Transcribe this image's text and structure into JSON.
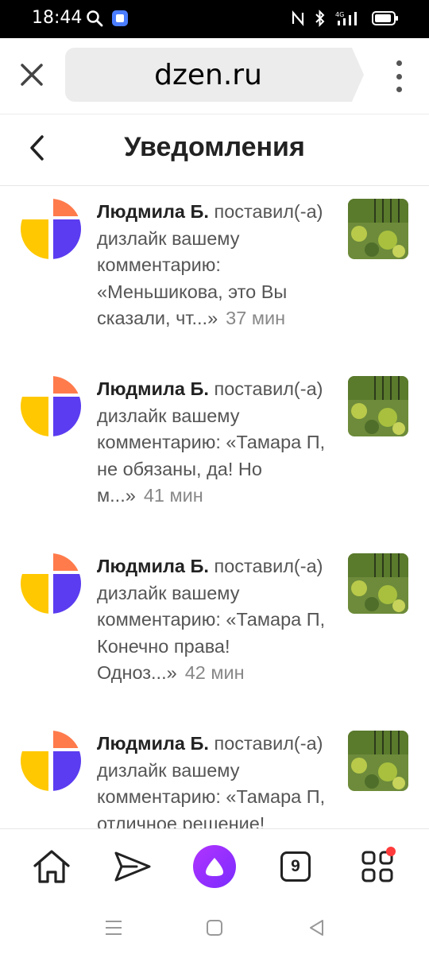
{
  "status_bar": {
    "time": "18:44",
    "network": "4G"
  },
  "browser": {
    "url": "dzen.ru"
  },
  "header": {
    "title": "Уведомления"
  },
  "notifications": [
    {
      "name": "Людмила Б.",
      "text": " поставил(-а) дизлайк вашему комментарию: «Меньшикова, это Вы сказали, чт...»",
      "time": "37 мин"
    },
    {
      "name": "Людмила Б.",
      "text": " поставил(-а) дизлайк вашему комментарию: «Тамара П, не обязаны, да! Но м...»",
      "time": "41 мин"
    },
    {
      "name": "Людмила Б.",
      "text": " поставил(-а) дизлайк вашему комментарию: «Тамара П, Конечно права! Одноз...»",
      "time": "42 мин"
    },
    {
      "name": "Людмила Б.",
      "text": " поставил(-а) дизлайк вашему комментарию: «Тамара П, отличное решение!",
      "time": ""
    }
  ],
  "bottom_nav": {
    "tabs_count": "9"
  },
  "colors": {
    "avatar_yellow": "#ffc800",
    "avatar_purple": "#5b3cf0",
    "avatar_orange": "#ff7b4c",
    "alice_purple": "#8c2cff",
    "badge_red": "#ff3b3b"
  }
}
